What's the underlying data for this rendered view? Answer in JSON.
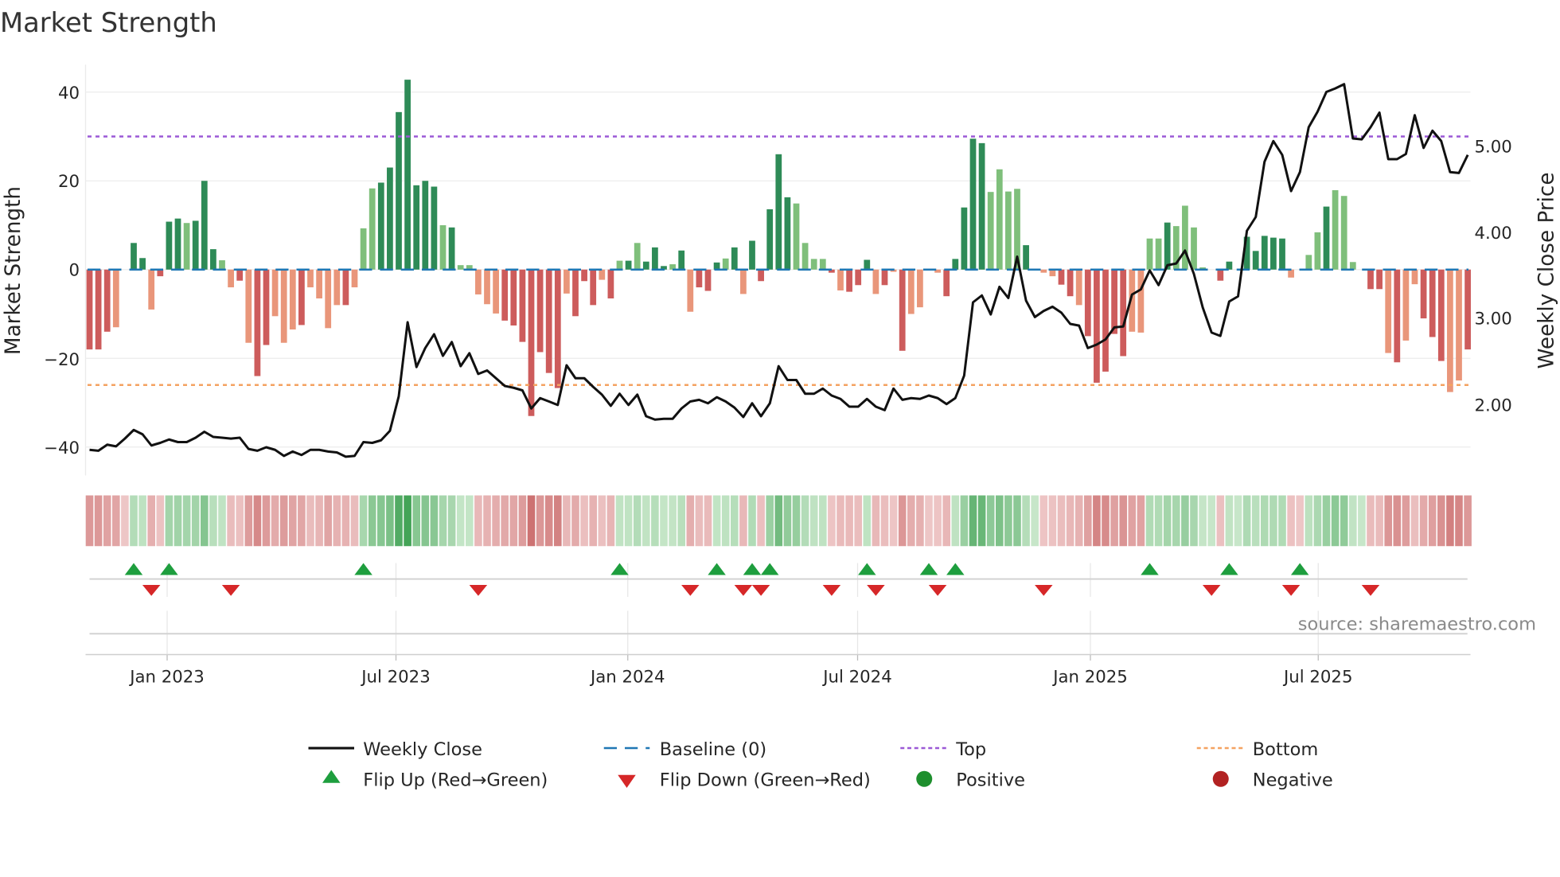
{
  "chart_data": {
    "type": "bar+line",
    "title": "Market Strength",
    "ylabel": "Market Strength",
    "y2label": "Weekly Close Price",
    "ylim": [
      -45,
      44
    ],
    "y2lim": [
      1.35,
      5.9
    ],
    "yticks": [
      "40",
      "20",
      "0",
      "−20",
      "−40"
    ],
    "y2ticks": [
      "5.00",
      "4.00",
      "3.00",
      "2.00"
    ],
    "xticks": [
      "Jan 2023",
      "Jul 2023",
      "Jan 2024",
      "Jul 2024",
      "Jan 2025",
      "Jul 2025"
    ],
    "frequency": "weekly",
    "start_week": "2022-10-31",
    "top_level": 30,
    "bottom_level": -26,
    "baseline": 0,
    "strength": [
      -18,
      -18,
      -14,
      -13,
      0,
      6,
      2.6,
      -9,
      -1.5,
      10.8,
      11.5,
      10.5,
      11,
      20,
      4.6,
      2.1,
      -4,
      -2.5,
      -16.5,
      -24,
      -17,
      -10.5,
      -16.5,
      -13.5,
      -12.5,
      -4,
      -6.5,
      -13.2,
      -8,
      -8,
      -4,
      9.3,
      18.3,
      19.6,
      23,
      35.5,
      42.8,
      19,
      20,
      18.7,
      10,
      9.5,
      1,
      1,
      -5.6,
      -7.8,
      -9.9,
      -11.5,
      -12.6,
      -16.3,
      -33,
      -18.6,
      -23.3,
      -26.7,
      -5.4,
      -10.5,
      -2.6,
      -8,
      -2.3,
      -6.5,
      2,
      2,
      6,
      1.8,
      5,
      0.8,
      1.2,
      4.3,
      -9.5,
      -4,
      -4.8,
      1.6,
      2.5,
      5,
      -5.5,
      6.5,
      -2.6,
      13.6,
      26,
      16.3,
      14.9,
      6,
      2.4,
      2.4,
      -0.7,
      -4.7,
      -5,
      -3.5,
      2.2,
      -5.5,
      -3.5,
      -0.5,
      -18.3,
      -10,
      -8.5,
      0,
      -0.7,
      -6,
      2.4,
      14,
      29.5,
      28.5,
      17.5,
      22.6,
      17.6,
      18.2,
      5.5,
      0,
      -0.7,
      -1.5,
      -3.4,
      -6,
      -8,
      -15,
      -25.5,
      -23,
      -14.5,
      -19.5,
      -14,
      -14.2,
      7,
      7,
      10.6,
      9.8,
      14.4,
      9.5,
      0.5,
      0,
      -2.5,
      1.8,
      0,
      7.4,
      4.2,
      7.6,
      7.2,
      7,
      -1.8,
      0,
      3.3,
      8.4,
      14.2,
      17.9,
      16.6,
      1.7,
      0,
      -4.4,
      -4.4,
      -18.8,
      -20.9,
      -16,
      -3.3,
      -11,
      -15.2,
      -20.6,
      -27.6,
      -25,
      -18
    ],
    "strength_tone": "dddllddldddldddlldlddllldlllldllldddddddldllllldddddddldddldldldddldldddldldddddlllldldddldldlllldddddlllldlllddldddddlllldlllldddldddddlllldllldddldlldddlldldlllldddddllddlllddddllll",
    "weekly_close": [
      1.48,
      1.47,
      1.54,
      1.52,
      1.61,
      1.71,
      1.66,
      1.53,
      1.56,
      1.6,
      1.57,
      1.57,
      1.62,
      1.69,
      1.63,
      1.62,
      1.61,
      1.62,
      1.49,
      1.47,
      1.51,
      1.48,
      1.41,
      1.46,
      1.42,
      1.48,
      1.48,
      1.46,
      1.45,
      1.4,
      1.41,
      1.57,
      1.56,
      1.59,
      1.7,
      2.1,
      2.96,
      2.44,
      2.66,
      2.82,
      2.57,
      2.73,
      2.45,
      2.6,
      2.36,
      2.4,
      2.31,
      2.22,
      2.2,
      2.17,
      1.96,
      2.08,
      2.04,
      2.0,
      2.46,
      2.31,
      2.31,
      2.21,
      2.12,
      1.99,
      2.13,
      2.0,
      2.12,
      1.87,
      1.83,
      1.84,
      1.84,
      1.96,
      2.04,
      2.06,
      2.02,
      2.09,
      2.04,
      1.97,
      1.86,
      2.02,
      1.87,
      2.02,
      2.45,
      2.29,
      2.29,
      2.13,
      2.13,
      2.19,
      2.11,
      2.07,
      1.98,
      1.98,
      2.07,
      1.98,
      1.94,
      2.19,
      2.06,
      2.08,
      2.07,
      2.11,
      2.08,
      2.01,
      2.08,
      2.34,
      3.19,
      3.27,
      3.05,
      3.37,
      3.24,
      3.72,
      3.21,
      3.02,
      3.09,
      3.14,
      3.07,
      2.94,
      2.92,
      2.66,
      2.7,
      2.76,
      2.9,
      2.91,
      3.28,
      3.34,
      3.56,
      3.39,
      3.62,
      3.64,
      3.79,
      3.52,
      3.13,
      2.84,
      2.8,
      3.2,
      3.26,
      4.02,
      4.18,
      4.82,
      5.06,
      4.9,
      4.48,
      4.7,
      5.22,
      5.4,
      5.63,
      5.67,
      5.72,
      5.09,
      5.08,
      5.22,
      5.39,
      4.85,
      4.85,
      4.91,
      5.36,
      4.98,
      5.18,
      5.06,
      4.7,
      4.69,
      4.9
    ],
    "flip_up_weeks": [
      5,
      9,
      31,
      60,
      71,
      75,
      77,
      88,
      95,
      98,
      120,
      129,
      137
    ],
    "flip_down_weeks": [
      7,
      16,
      44,
      68,
      74,
      76,
      84,
      89,
      96,
      108,
      127,
      136,
      145
    ],
    "grid": true,
    "legend_placement": "bottom"
  },
  "title": "Market Strength",
  "source": "source: sharemaestro.com",
  "legend": [
    {
      "label": "Weekly Close"
    },
    {
      "label": "Baseline (0)"
    },
    {
      "label": "Top"
    },
    {
      "label": "Bottom"
    },
    {
      "label": "Flip Up (Red→Green)"
    },
    {
      "label": "Flip Down (Green→Red)"
    },
    {
      "label": "Positive"
    },
    {
      "label": "Negative"
    }
  ],
  "colors": {
    "pos_strong": "#2e8b57",
    "pos_weak": "#7fbf7b",
    "neg_strong": "#cd5c5c",
    "neg_weak": "#e9967a",
    "baseline": "#1f77b4",
    "top": "#9b59d6",
    "bottom": "#f4a261",
    "close": "#111111",
    "flip_up": "#1e9e3e",
    "flip_down": "#d62728",
    "positive": "#1e8f2e",
    "negative": "#b22222"
  }
}
